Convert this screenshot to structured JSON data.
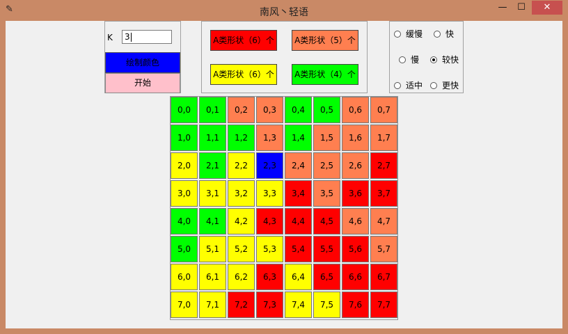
{
  "window": {
    "title": "南风丶轻语",
    "minimize_glyph": "—",
    "maximize_glyph": "☐",
    "close_glyph": "✕",
    "icon": "feather-icon"
  },
  "k_panel": {
    "label": "K",
    "value": "3",
    "color_button_label": "绘制颜色",
    "start_button_label": "开始"
  },
  "shape_buttons": [
    {
      "label": "A类形状（6）个",
      "color": "#ff0000"
    },
    {
      "label": "A类形状（5）个",
      "color": "#ff7f50"
    },
    {
      "label": "A类形状（6）个",
      "color": "#ffff00"
    },
    {
      "label": "A类形状（4）个",
      "color": "#00ff00"
    }
  ],
  "speed": {
    "options": [
      "缓慢",
      "快",
      "慢",
      "较快",
      "适中",
      "更快"
    ],
    "selected": "较快"
  },
  "colors": {
    "R": "#ff0000",
    "O": "#ff7f50",
    "Y": "#ffff00",
    "G": "#00ff00",
    "B": "#0000ff"
  },
  "grid": {
    "rows": [
      [
        "G",
        "G",
        "O",
        "O",
        "G",
        "G",
        "O",
        "O"
      ],
      [
        "G",
        "G",
        "G",
        "O",
        "G",
        "O",
        "O",
        "O"
      ],
      [
        "Y",
        "G",
        "Y",
        "B",
        "O",
        "O",
        "O",
        "R"
      ],
      [
        "Y",
        "Y",
        "Y",
        "Y",
        "R",
        "O",
        "R",
        "R"
      ],
      [
        "G",
        "G",
        "Y",
        "R",
        "R",
        "R",
        "O",
        "O"
      ],
      [
        "G",
        "Y",
        "Y",
        "Y",
        "R",
        "R",
        "R",
        "O"
      ],
      [
        "Y",
        "Y",
        "Y",
        "R",
        "Y",
        "R",
        "R",
        "R"
      ],
      [
        "Y",
        "Y",
        "R",
        "R",
        "Y",
        "Y",
        "R",
        "R"
      ]
    ]
  }
}
